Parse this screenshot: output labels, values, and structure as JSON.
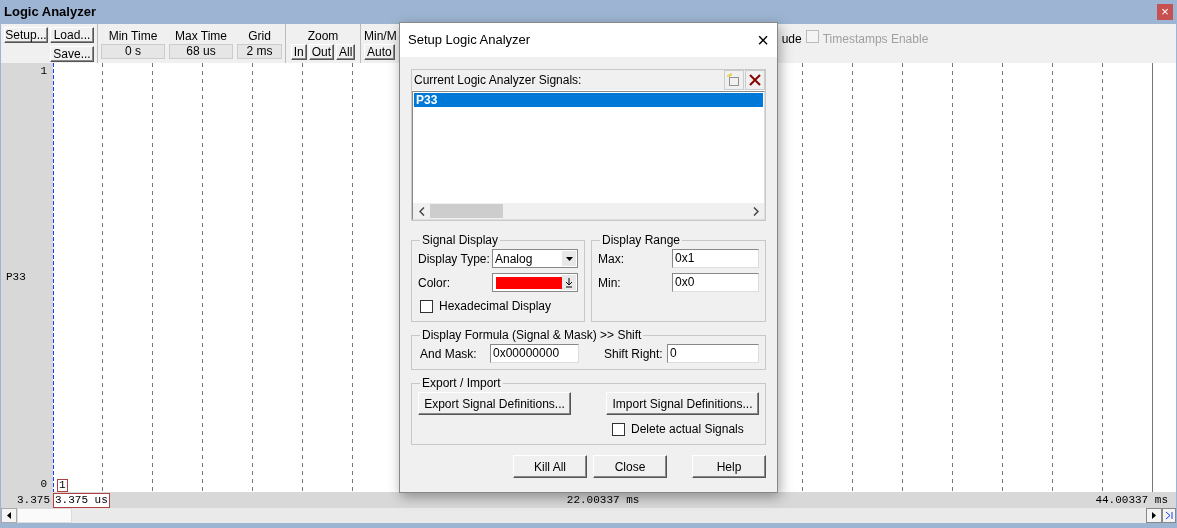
{
  "window": {
    "title": "Logic Analyzer",
    "close": "×"
  },
  "toolbar": {
    "file_buttons": [
      "Setup...",
      "Load...",
      "Save..."
    ],
    "readouts": [
      {
        "label": "Min Time",
        "value": "0 s"
      },
      {
        "label": "Max Time",
        "value": "68 us"
      },
      {
        "label": "Grid",
        "value": "2 ms"
      }
    ],
    "zoom": {
      "label": "Zoom",
      "buttons": [
        "In",
        "Out",
        "All"
      ]
    },
    "minmax": {
      "label": "Min/M",
      "buttons": [
        "Auto"
      ]
    },
    "cut_label": "ude",
    "timestamps": {
      "label": "Timestamps Enable",
      "checked": false,
      "disabled": true
    }
  },
  "plot": {
    "y_max": "1",
    "y_min": "0",
    "signal": "P33",
    "cursor_marker": "1",
    "start": "3.375",
    "cursor_time": "3.375 us",
    "mid_time": "22.00337 ms",
    "end_time": "44.00337 ms"
  },
  "dialog": {
    "title": "Setup Logic Analyzer",
    "close": "×",
    "signals_label": "Current Logic Analyzer Signals:",
    "signals": [
      {
        "name": "P33",
        "selected": true
      }
    ],
    "signal_display": {
      "title": "Signal Display",
      "type_label": "Display Type:",
      "type_value": "Analog",
      "color_label": "Color:",
      "color": "#ff0000",
      "hex": {
        "label": "Hexadecimal Display",
        "checked": false
      }
    },
    "range": {
      "title": "Display Range",
      "max_label": "Max:",
      "max": "0x1",
      "min_label": "Min:",
      "min": "0x0"
    },
    "formula": {
      "title": "Display Formula (Signal & Mask) >> Shift",
      "mask_label": "And Mask:",
      "mask": "0x00000000",
      "shift_label": "Shift Right:",
      "shift": "0"
    },
    "export": {
      "title": "Export / Import",
      "export_button": "Export Signal Definitions...",
      "import_button": "Import Signal Definitions...",
      "delete": {
        "label": "Delete actual Signals",
        "checked": false
      }
    },
    "buttons": [
      "Kill All",
      "Close",
      "Help"
    ]
  }
}
